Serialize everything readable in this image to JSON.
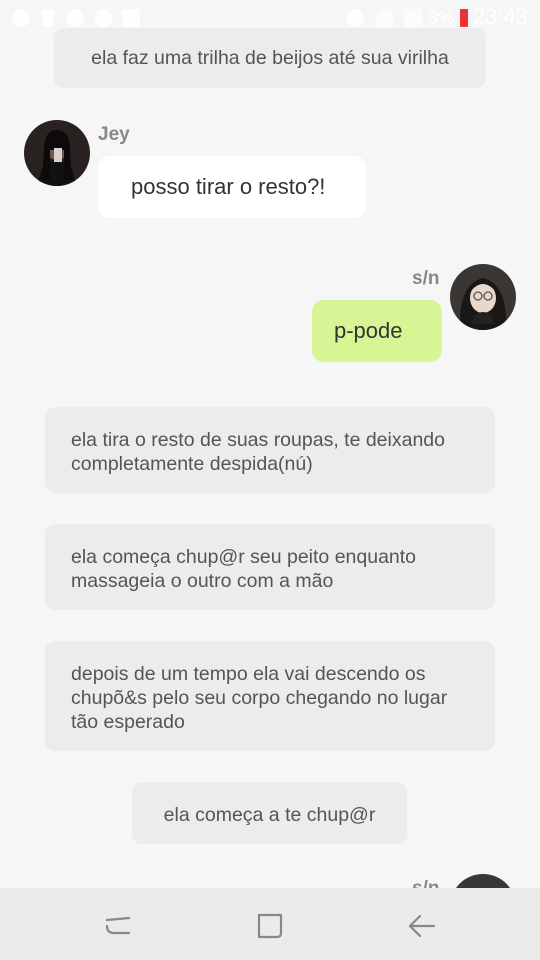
{
  "status_bar": {
    "battery_percent": "3%",
    "time": "23:43",
    "icons": [
      "whatsapp-icon",
      "battery-saver-icon",
      "app-icon",
      "settings-icon",
      "image-icon",
      "do-not-disturb-icon",
      "wifi-icon",
      "signal-icon",
      "battery-alert-icon"
    ]
  },
  "chat": {
    "narration_top": "ela faz uma trilha de beijos até sua virilha",
    "msg_jey": {
      "sender": "Jey",
      "text": "posso tirar o resto?!"
    },
    "msg_sn": {
      "sender": "s/n",
      "text": "p-pode",
      "bubble_color": "#d7f594"
    },
    "narration_1": "ela tira o resto de suas roupas, te deixando completamente despida(nú)",
    "narration_2": "ela começa chup@r seu peito enquanto massageia o outro com a mão",
    "narration_3": "depois de um tempo ela vai descendo os chupõ&s pelo seu corpo chegando no lugar tão esperado",
    "narration_4": "ela começa a te chup@r",
    "partial_sender": "s/n"
  },
  "nav_bar": {
    "buttons": [
      "recent-apps-icon",
      "home-icon",
      "back-icon"
    ]
  }
}
